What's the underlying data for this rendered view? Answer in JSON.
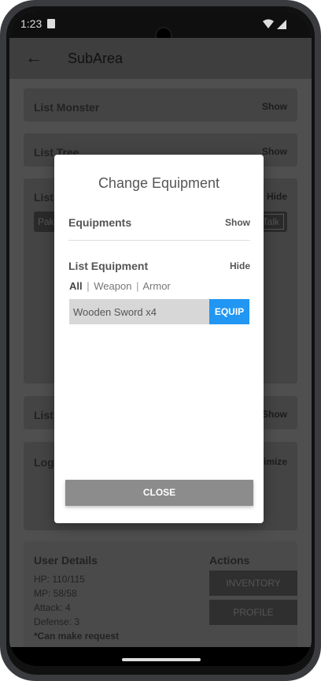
{
  "status_bar": {
    "time": "1:23"
  },
  "app_bar": {
    "title": "SubArea",
    "back_icon": "arrow-left-icon"
  },
  "background": {
    "cards": [
      {
        "label": "List Monster",
        "toggle": "Show"
      },
      {
        "label": "List Tree",
        "toggle": "Show"
      },
      {
        "label": "List N",
        "toggle": "Hide",
        "chip_left": "Pak l",
        "chip_right": "Talk"
      },
      {
        "label": "List U",
        "toggle": "Show"
      },
      {
        "label": "Logs",
        "toggle": "imize"
      }
    ],
    "user_details": {
      "title": "User Details",
      "hp": "HP: 110/115",
      "mp": "MP: 58/58",
      "attack": "Attack: 4",
      "defense": "Defense: 3",
      "note": "*Can make request"
    },
    "actions": {
      "title": "Actions",
      "inventory": "INVENTORY",
      "profile": "PROFILE"
    }
  },
  "dialog": {
    "title": "Change Equipment",
    "equipments": {
      "label": "Equipments",
      "toggle": "Show"
    },
    "list_equipment": {
      "label": "List Equipment",
      "toggle": "Hide"
    },
    "filters": {
      "all": "All",
      "sep1": "|",
      "weapon": "Weapon",
      "sep2": "|",
      "armor": "Armor"
    },
    "items": [
      {
        "name": "Wooden Sword x4",
        "action": "EQUIP"
      }
    ],
    "close_label": "CLOSE"
  },
  "colors": {
    "accent": "#2196f3",
    "close_button": "#8c8c8c"
  }
}
